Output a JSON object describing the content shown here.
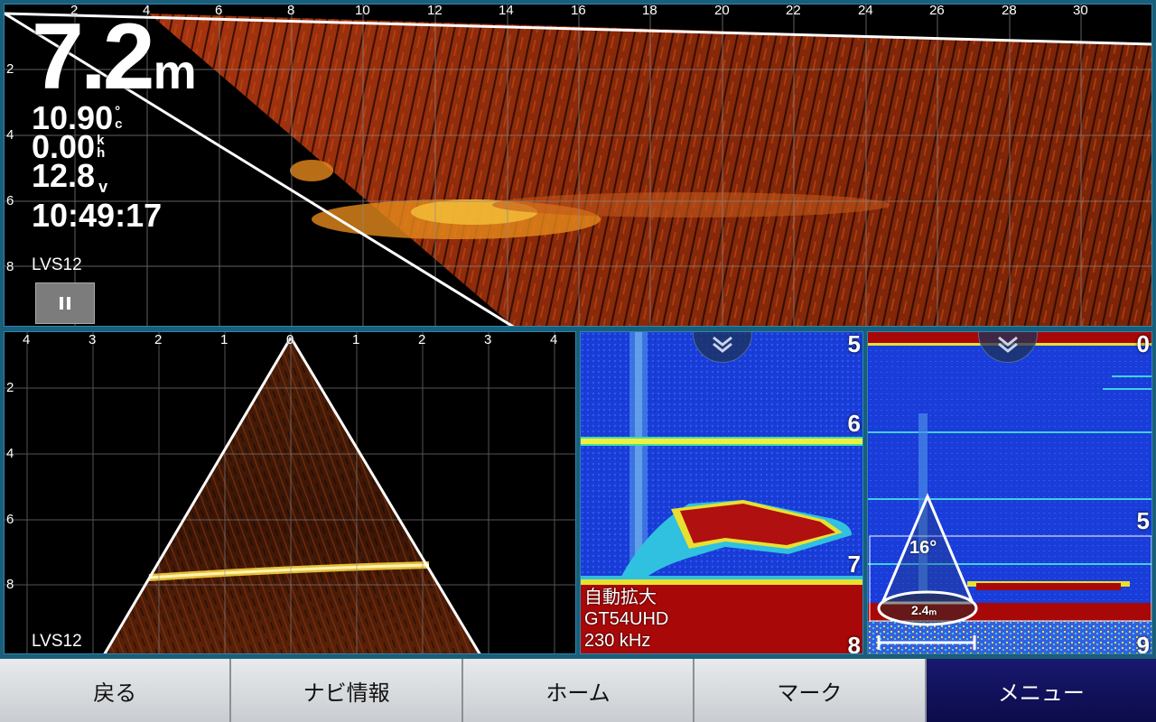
{
  "top_pane": {
    "x_ticks": [
      "2",
      "4",
      "6",
      "8",
      "10",
      "12",
      "14",
      "16",
      "18",
      "20",
      "22",
      "24",
      "26",
      "28",
      "30"
    ],
    "y_ticks": [
      "2",
      "4",
      "6",
      "8"
    ],
    "depth_value": "7.2",
    "depth_unit": "m",
    "water_temp": "10.90",
    "water_temp_unit": "°c",
    "speed": "0.00",
    "speed_unit": "kh",
    "voltage": "12.8",
    "voltage_unit": "v",
    "time": "10:49:17",
    "mode_label": "LVS12",
    "pause_icon": "pause-icon"
  },
  "fan_pane": {
    "x_ticks": [
      "4",
      "3",
      "2",
      "1",
      "0",
      "1",
      "2",
      "3",
      "4"
    ],
    "y_ticks": [
      "2",
      "4",
      "6",
      "8"
    ],
    "mode_label": "LVS12"
  },
  "sonar_2d_pane": {
    "scale": [
      "5",
      "6",
      "7",
      "8"
    ],
    "lines": [
      "自動拡大",
      "GT54UHD",
      "230 kHz"
    ],
    "collapse_icon": "chevron-double-down-icon"
  },
  "uhd_pane": {
    "scale": [
      "0",
      "5",
      "9"
    ],
    "cone_angle": "16°",
    "cone_width": "2.4ₘ",
    "collapse_icon": "chevron-double-down-icon"
  },
  "bottom_bar": {
    "buttons": [
      "戻る",
      "ナビ情報",
      "ホーム",
      "マーク",
      "メニュー"
    ]
  }
}
